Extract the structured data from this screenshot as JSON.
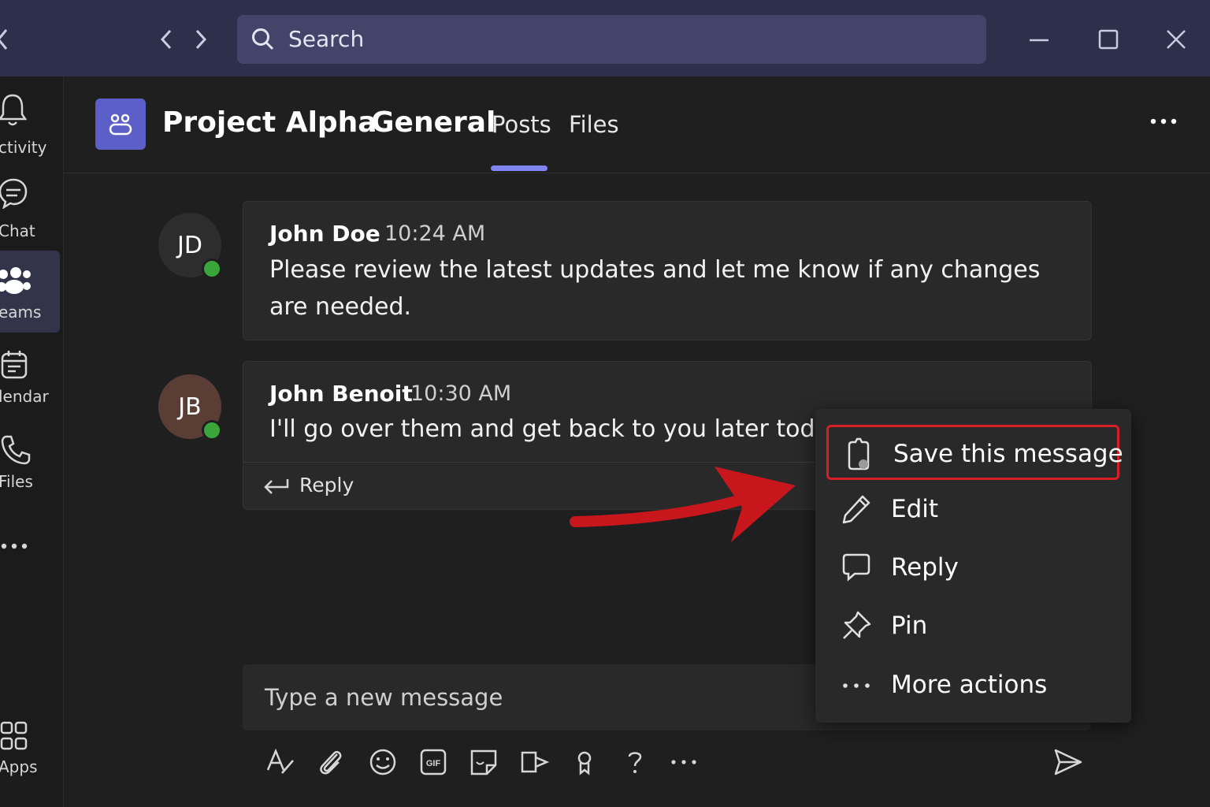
{
  "search": {
    "placeholder": "Search"
  },
  "rail": {
    "items": [
      {
        "label": "ctivity"
      },
      {
        "label": "Chat"
      },
      {
        "label": "eams"
      },
      {
        "label": "lendar"
      },
      {
        "label": "Files"
      },
      {
        "label": "Apps"
      }
    ]
  },
  "header": {
    "team": "Project Alpha",
    "channel": "General",
    "tabs": [
      {
        "label": "Posts"
      },
      {
        "label": "Files"
      }
    ],
    "active_tab": "Posts"
  },
  "messages": [
    {
      "initials": "JD",
      "author": "John Doe",
      "time": "10:24 AM",
      "body": "Please review the latest updates and let me know if any changes are needed.",
      "presence_color": "#3aa63a"
    },
    {
      "initials": "JB",
      "author": "John Benoit",
      "time": "10:30 AM",
      "body": "I'll go over them and get back to you later today.",
      "reply_label": "Reply",
      "presence_color": "#3aa63a"
    }
  ],
  "compose": {
    "placeholder": "Type a new message"
  },
  "context_menu": {
    "items": [
      {
        "label": "Save this message",
        "icon": "bookmark-icon",
        "highlighted": true
      },
      {
        "label": "Edit",
        "icon": "pencil-icon"
      },
      {
        "label": "Reply",
        "icon": "speech-bubble-icon"
      },
      {
        "label": "Pin",
        "icon": "pin-icon"
      },
      {
        "label": "More actions",
        "icon": "ellipsis-icon"
      }
    ]
  },
  "colors": {
    "accent": "#5b5fc7",
    "tab_underline": "#7f85f5",
    "highlight": "#d81f26",
    "titlebar": "#2e2f4a",
    "online": "#3aa63a"
  }
}
